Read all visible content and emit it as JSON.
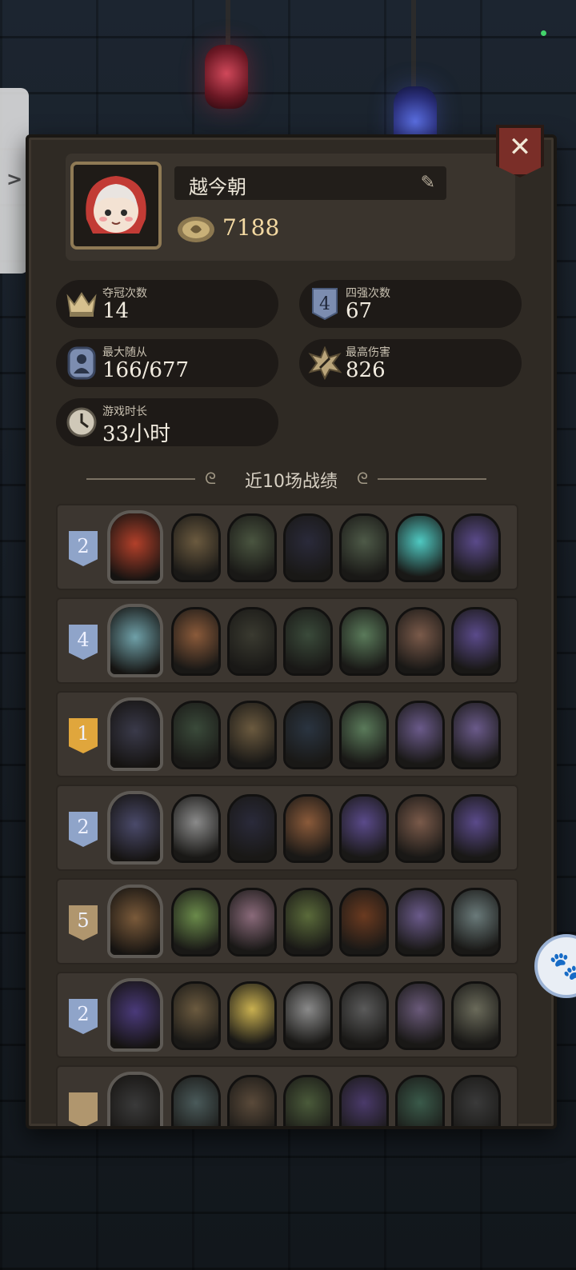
{
  "profile": {
    "name": "越今朝",
    "coins": "7188",
    "avatar_icon": "red-hood-girl-avatar",
    "coin_icon": "gold-coin-icon",
    "edit_icon": "pencil-icon"
  },
  "stats": [
    {
      "label": "夺冠次数",
      "value": "14",
      "icon": "crown-icon"
    },
    {
      "label": "四强次数",
      "value": "67",
      "icon": "rank-4-badge-icon"
    },
    {
      "label": "最大随从",
      "value": "166/677",
      "icon": "minion-card-icon"
    },
    {
      "label": "最高伤害",
      "value": "826",
      "icon": "damage-burst-icon"
    },
    {
      "label": "游戏时长",
      "value": "33小时",
      "icon": "clock-icon"
    }
  ],
  "section_title": "近10场战绩",
  "matches": [
    {
      "rank": "2",
      "rank_color": "#8fa4c9",
      "hero_color": "#b2402a",
      "minions": [
        "#6b5a3f",
        "#4a5540",
        "#2a2a3a",
        "#4e5a48",
        "#4fc9c2",
        "#5a4a8a"
      ]
    },
    {
      "rank": "4",
      "rank_color": "#8fa4c9",
      "hero_color": "#6fa0a8",
      "minions": [
        "#8a5a3a",
        "#3a3a30",
        "#3a4a3a",
        "#5a7a5a",
        "#7a5a4a",
        "#5a4a8a"
      ]
    },
    {
      "rank": "1",
      "rank_color": "#e0a63c",
      "hero_color": "#3a3a4a",
      "minions": [
        "#3a4a3a",
        "#6b5a3f",
        "#2a3440",
        "#5a7a5a",
        "#6a5a8a",
        "#6a5a8a"
      ]
    },
    {
      "rank": "2",
      "rank_color": "#8fa4c9",
      "hero_color": "#4a4a6a",
      "minions": [
        "#8a8a8a",
        "#2a2a3a",
        "#8a5a3a",
        "#5a4a8a",
        "#7a5a4a",
        "#5a4a8a"
      ]
    },
    {
      "rank": "5",
      "rank_color": "#b0966e",
      "hero_color": "#7a5a3a",
      "minions": [
        "#6a8a4a",
        "#8a6a7a",
        "#5a6a3a",
        "#6a3a20",
        "#6a5a8a",
        "#6a7a7a"
      ]
    },
    {
      "rank": "2",
      "rank_color": "#8fa4c9",
      "hero_color": "#4a3a7a",
      "minions": [
        "#6b5a3f",
        "#c9b050",
        "#8a8a8a",
        "#5a5a5a",
        "#6a5a7a",
        "#6a6a5a"
      ]
    },
    {
      "rank": "",
      "rank_color": "#b0966e",
      "hero_color": "#3a3a3a",
      "minions": [
        "#4a5a5a",
        "#5a4a3a",
        "#4a5a3a",
        "#4a3a6a",
        "#3a5a4a",
        "#3a3a3a"
      ]
    }
  ],
  "colors": {
    "panel": "#2f2a24",
    "row": "#3c3630",
    "chip": "#1e1a17",
    "accent_gold": "#f3d9a2",
    "close_red": "#7a2e28"
  }
}
